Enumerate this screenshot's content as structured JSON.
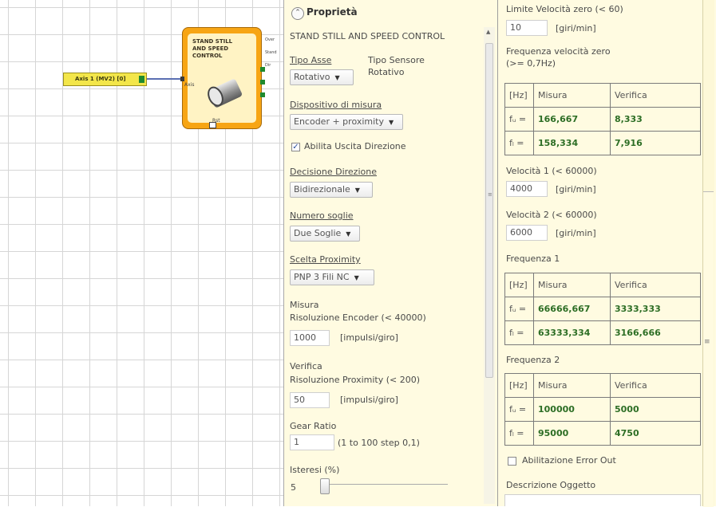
{
  "canvas": {
    "axis_block": {
      "label": "Axis 1 (MV2) [0]"
    },
    "function_block": {
      "title": "STAND STILL AND SPEED CONTROL",
      "input_label": "Axis",
      "output_labels": [
        "Over",
        "Stand",
        "Dir"
      ],
      "bottom_label": "Rst"
    }
  },
  "properties": {
    "header": "Proprietà",
    "component_name": "STAND STILL AND SPEED CONTROL",
    "tipo_asse": {
      "label": "Tipo Asse",
      "value": "Rotativo"
    },
    "tipo_sensore": {
      "label": "Tipo Sensore",
      "value": "Rotativo"
    },
    "dispositivo_misura": {
      "label": "Dispositivo di misura",
      "value": "Encoder + proximity"
    },
    "abilita_uscita_direzione": {
      "label": "Abilita Uscita Direzione",
      "checked": true
    },
    "decisione_direzione": {
      "label": "Decisione Direzione",
      "value": "Bidirezionale"
    },
    "numero_soglie": {
      "label": "Numero soglie",
      "value": "Due Soglie"
    },
    "scelta_proximity": {
      "label": "Scelta Proximity",
      "value": "PNP 3 Fili NC"
    },
    "misura": {
      "section": "Misura",
      "label": "Risoluzione Encoder  (< 40000)",
      "value": "1000",
      "unit": "[impulsi/giro]"
    },
    "verifica": {
      "section": "Verifica",
      "label": "Risoluzione Proximity  (< 200)",
      "value": "50",
      "unit": "[impulsi/giro]"
    },
    "gear_ratio": {
      "label": "Gear Ratio",
      "value": "1",
      "hint": "(1 to 100 step 0,1)"
    },
    "isteresi": {
      "label": "Isteresi (%)",
      "value": "5"
    }
  },
  "right": {
    "limite_velocita_zero": {
      "label": "Limite Velocità zero  (< 60)",
      "value": "10",
      "unit": "[giri/min]"
    },
    "frequenza_velocita_zero": {
      "label_line1": "Frequenza velocità zero",
      "label_line2": "(>= 0,7Hz)"
    },
    "table_zero": {
      "headers": [
        "[Hz]",
        "Misura",
        "Verifica"
      ],
      "rows": [
        {
          "key": "fᵤ =",
          "misura": "166,667",
          "verifica": "8,333"
        },
        {
          "key": "fₗ =",
          "misura": "158,334",
          "verifica": "7,916"
        }
      ]
    },
    "velocita_1": {
      "label": "Velocità 1  (< 60000)",
      "value": "4000",
      "unit": "[giri/min]"
    },
    "velocita_2": {
      "label": "Velocità 2  (< 60000)",
      "value": "6000",
      "unit": "[giri/min]"
    },
    "frequenza_1": {
      "label": "Frequenza 1",
      "headers": [
        "[Hz]",
        "Misura",
        "Verifica"
      ],
      "rows": [
        {
          "key": "fᵤ =",
          "misura": "66666,667",
          "verifica": "3333,333"
        },
        {
          "key": "fₗ =",
          "misura": "63333,334",
          "verifica": "3166,666"
        }
      ]
    },
    "frequenza_2": {
      "label": "Frequenza 2",
      "headers": [
        "[Hz]",
        "Misura",
        "Verifica"
      ],
      "rows": [
        {
          "key": "fᵤ =",
          "misura": "100000",
          "verifica": "5000"
        },
        {
          "key": "fₗ =",
          "misura": "95000",
          "verifica": "4750"
        }
      ]
    },
    "abilitazione_error_out": {
      "label": "Abilitazione Error Out",
      "checked": false
    },
    "descrizione_oggetto": {
      "label": "Descrizione Oggetto"
    }
  }
}
